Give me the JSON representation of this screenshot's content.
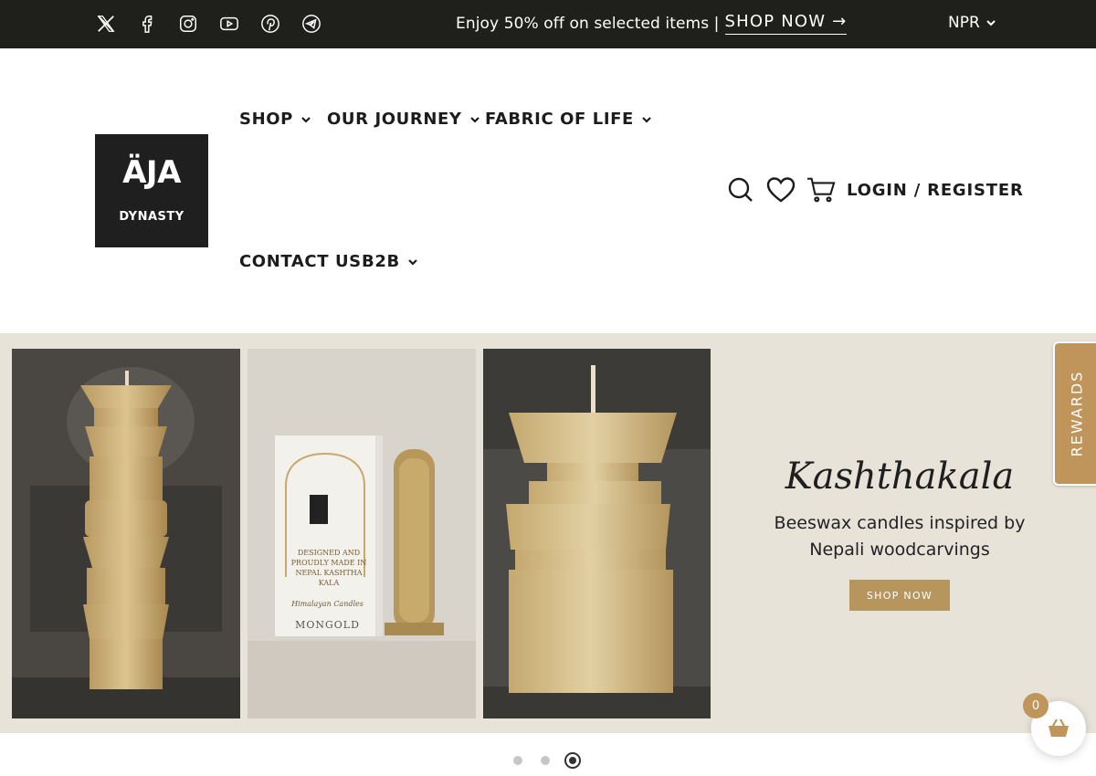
{
  "topbar": {
    "social_icons": [
      "x-icon",
      "facebook-icon",
      "instagram-icon",
      "youtube-icon",
      "pinterest-icon",
      "telegram-icon"
    ],
    "promo_text": "Enjoy 50% off on selected items |",
    "promo_link": "SHOP NOW →",
    "currency": "NPR"
  },
  "header": {
    "logo_line1": "ÄJA",
    "logo_line2": "DYNASTY",
    "nav": {
      "shop": "SHOP",
      "journey": "OUR JOURNEY",
      "fabric": "FABRIC OF LIFE",
      "contact": "CONTACT US",
      "b2b": "B2B"
    },
    "login": "LOGIN / REGISTER"
  },
  "hero": {
    "title": "Kashthakala",
    "subtitle": "Beeswax candles inspired by Nepali woodcarvings",
    "button": "SHOP NOW",
    "box_text": "DESIGNED AND PROUDLY MADE IN NEPAL KASHTHA KALA",
    "box_brand": "MONGOLD",
    "box_script": "Himalayan Candles"
  },
  "rewards_label": "REWARDS",
  "cart_count": "0",
  "slider": {
    "total": 3,
    "active": 3
  },
  "colors": {
    "topbar": "#1f1f1c",
    "accent": "#b6965c",
    "hero_bg": "#e8e3d8"
  }
}
